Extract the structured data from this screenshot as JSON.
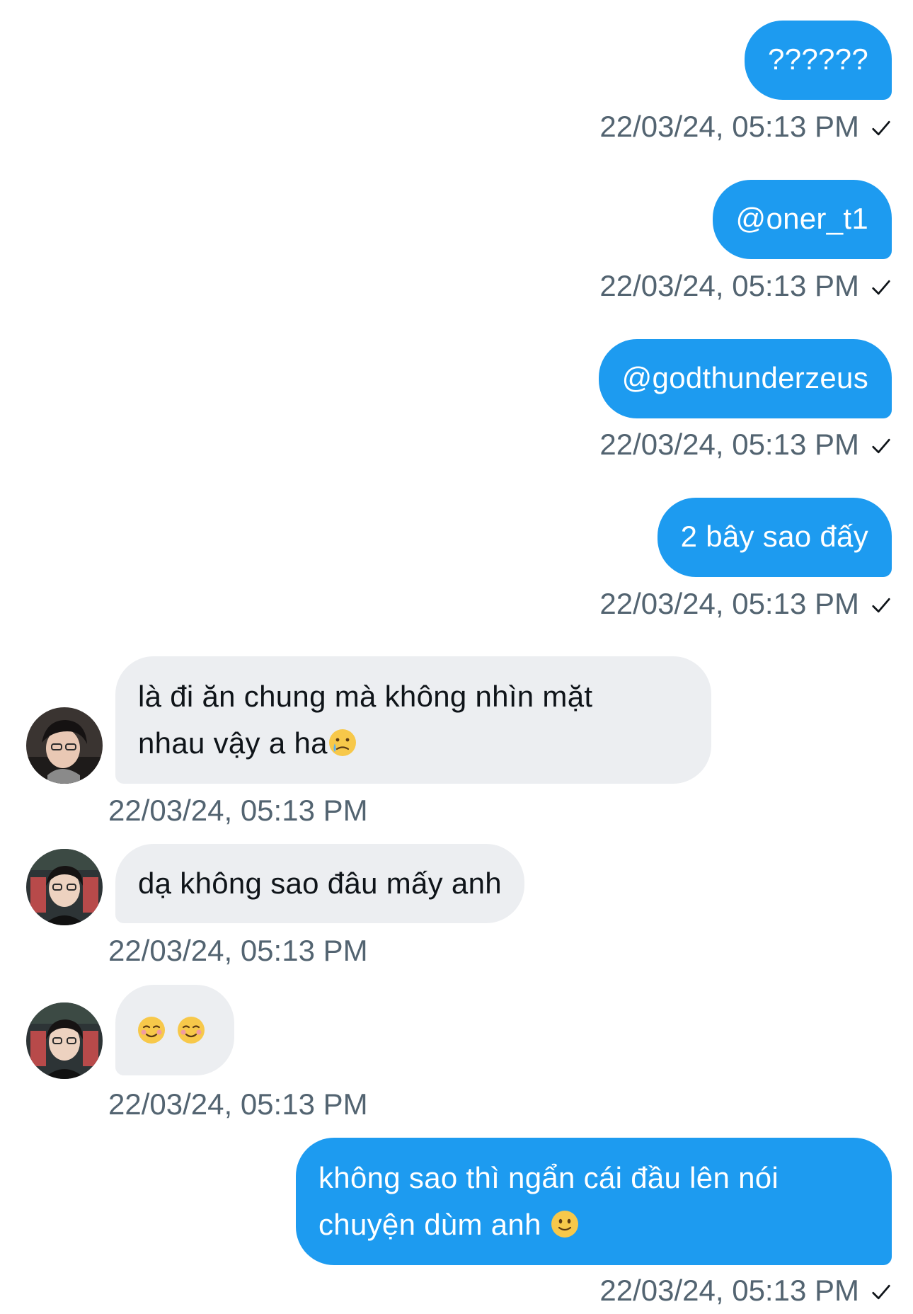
{
  "messages": [
    {
      "text": "??????",
      "time": "22/03/24, 05:13 PM"
    },
    {
      "text": "@oner_t1",
      "time": "22/03/24, 05:13 PM"
    },
    {
      "text": "@godthunderzeus",
      "time": "22/03/24, 05:13 PM"
    },
    {
      "text": "2 bây sao đấy",
      "time": "22/03/24, 05:13 PM"
    },
    {
      "line1": "là đi ăn chung mà không nhìn mặt",
      "line2": "nhau vậy a ha",
      "emoji": "crying-face",
      "time": "22/03/24, 05:13 PM"
    },
    {
      "text": "dạ không sao đâu mấy anh",
      "time": "22/03/24, 05:13 PM"
    },
    {
      "emoji": "smiling-face-x2",
      "time": "22/03/24, 05:13 PM"
    },
    {
      "line1": "không sao thì ngẩn cái đầu lên nói",
      "line2": "chuyện dùm anh ",
      "emoji": "slightly-smiling-face",
      "time": "22/03/24, 05:13 PM"
    }
  ],
  "colors": {
    "outgoing_bubble": "#1d9bf0",
    "incoming_bubble": "#eceef1",
    "timestamp": "#536471"
  },
  "icons": {
    "sent": "checkmark-icon",
    "avatar": "user-avatar"
  }
}
